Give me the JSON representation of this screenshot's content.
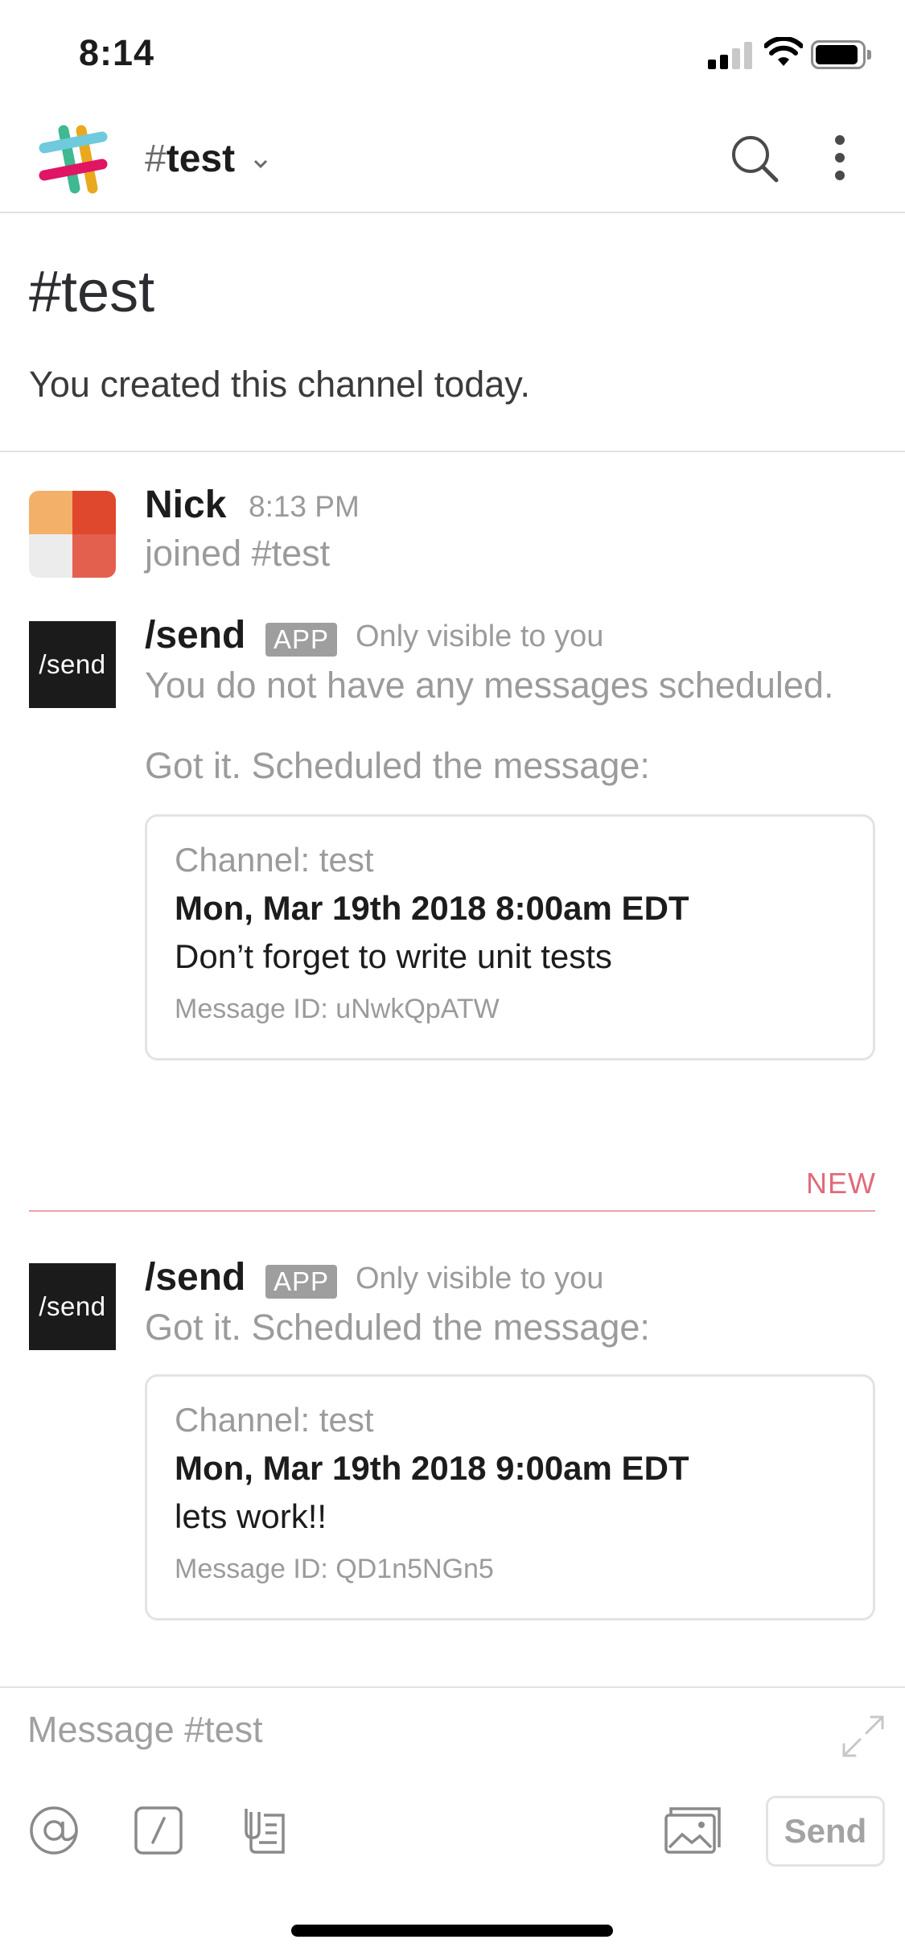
{
  "status_bar": {
    "time": "8:14"
  },
  "header": {
    "hash": "#",
    "channel": "test"
  },
  "intro": {
    "title": "#test",
    "subtitle": "You created this channel today."
  },
  "messages": [
    {
      "sender": "Nick",
      "time": "8:13 PM",
      "text": "joined #test"
    },
    {
      "sender": "/send",
      "badge": "APP",
      "visibility": "Only visible to you",
      "avatar_text": "/send",
      "lines": [
        "You do not have any messages scheduled.",
        "Got it. Scheduled the message:"
      ],
      "card": {
        "channel": "Channel: test",
        "date": "Mon, Mar 19th 2018 8:00am EDT",
        "text": "Don’t forget to write unit tests",
        "message_id": "Message ID: uNwkQpATW"
      }
    },
    {
      "sender": "/send",
      "badge": "APP",
      "visibility": "Only visible to you",
      "avatar_text": "/send",
      "lines": [
        "Got it. Scheduled the message:"
      ],
      "card": {
        "channel": "Channel: test",
        "date": "Mon, Mar 19th 2018 9:00am EDT",
        "text": "lets work!!",
        "message_id": "Message ID: QD1n5NGn5"
      }
    }
  ],
  "new_divider": {
    "label": "NEW",
    "color": "#e06b7a"
  },
  "composer": {
    "placeholder": "Message #test",
    "send_label": "Send"
  },
  "icons": [
    "slack-logo",
    "chevron-down-icon",
    "search-icon",
    "more-vertical-icon",
    "expand-icon",
    "at-icon",
    "slash-command-icon",
    "file-icon",
    "image-icon"
  ]
}
